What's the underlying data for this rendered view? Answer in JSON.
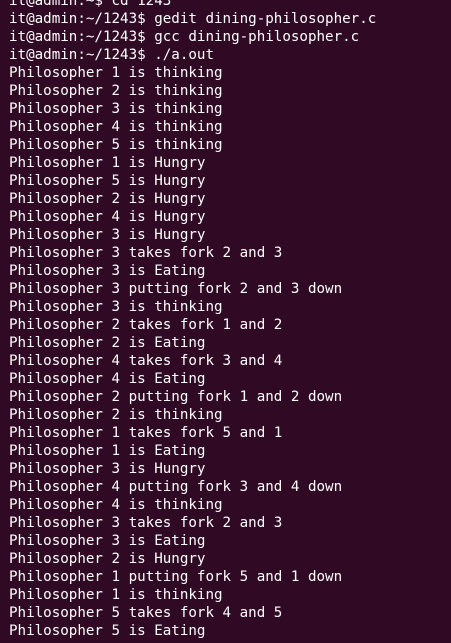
{
  "terminal": {
    "background_color": "#300a24",
    "text_color": "#ffffff",
    "lines": [
      "it@admin:~$ cd 1243",
      "it@admin:~/1243$ gedit dining-philosopher.c",
      "it@admin:~/1243$ gcc dining-philosopher.c",
      "it@admin:~/1243$ ./a.out",
      "Philosopher 1 is thinking",
      "Philosopher 2 is thinking",
      "Philosopher 3 is thinking",
      "Philosopher 4 is thinking",
      "Philosopher 5 is thinking",
      "Philosopher 1 is Hungry",
      "Philosopher 5 is Hungry",
      "Philosopher 2 is Hungry",
      "Philosopher 4 is Hungry",
      "Philosopher 3 is Hungry",
      "Philosopher 3 takes fork 2 and 3",
      "Philosopher 3 is Eating",
      "Philosopher 3 putting fork 2 and 3 down",
      "Philosopher 3 is thinking",
      "Philosopher 2 takes fork 1 and 2",
      "Philosopher 2 is Eating",
      "Philosopher 4 takes fork 3 and 4",
      "Philosopher 4 is Eating",
      "Philosopher 2 putting fork 1 and 2 down",
      "Philosopher 2 is thinking",
      "Philosopher 1 takes fork 5 and 1",
      "Philosopher 1 is Eating",
      "Philosopher 3 is Hungry",
      "Philosopher 4 putting fork 3 and 4 down",
      "Philosopher 4 is thinking",
      "Philosopher 3 takes fork 2 and 3",
      "Philosopher 3 is Eating",
      "Philosopher 2 is Hungry",
      "Philosopher 1 putting fork 5 and 1 down",
      "Philosopher 1 is thinking",
      "Philosopher 5 takes fork 4 and 5",
      "Philosopher 5 is Eating"
    ]
  }
}
